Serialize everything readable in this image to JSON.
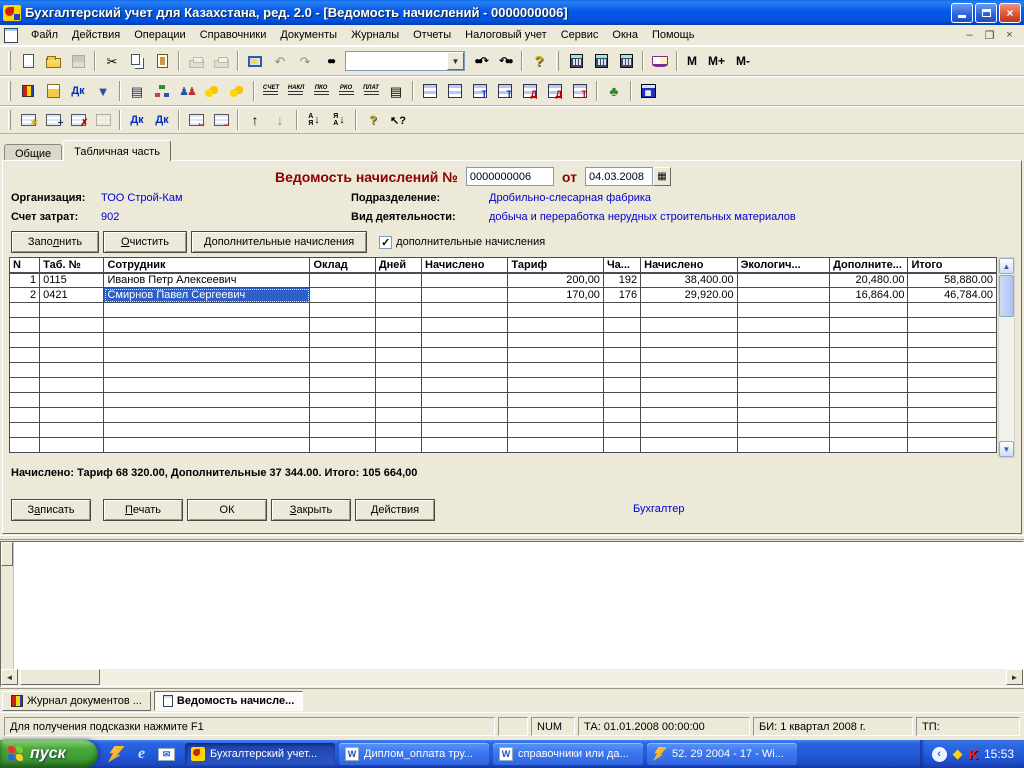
{
  "title_bar": {
    "title": "Бухгалтерский учет для Казахстана, ред. 2.0 - [Ведомость начислений - 0000000006]"
  },
  "menu_bar": {
    "items": [
      "Файл",
      "Действия",
      "Операции",
      "Справочники",
      "Документы",
      "Журналы",
      "Отчеты",
      "Налоговый учет",
      "Сервис",
      "Окна",
      "Помощь"
    ]
  },
  "toolbars": {
    "memory": [
      "M",
      "M+",
      "M-"
    ],
    "doc_buttons": [
      "СЧЕТ",
      "НАКЛ",
      "ПКО",
      "РКО",
      "ПЛАТ"
    ],
    "dk": "Дк",
    "sort_a": "А",
    "sort_z": "Я",
    "find_value": ""
  },
  "tabs": {
    "items": [
      "Общие",
      "Табличная часть"
    ]
  },
  "form": {
    "doc_title": "Ведомость начислений №",
    "doc_number": "0000000006",
    "from_label": "от",
    "doc_date": "04.03.2008",
    "org_label": "Организация:",
    "org_value": "ТОО Строй-Кам",
    "dept_label": "Подразделение:",
    "dept_value": "Дробильно-слесарная фабрика",
    "account_label": "Счет затрат:",
    "account_value": "902",
    "activity_label": "Вид деятельности:",
    "activity_value": "добыча и переработка нерудных строительных материалов",
    "fill": [
      "Запо",
      "л",
      "нить"
    ],
    "clear": [
      "",
      "О",
      "чистить"
    ],
    "additional": "Дополнительные начисления",
    "checkbox_label": "дополнительные начисления",
    "checkbox_checked": "✓",
    "totals": "Начислено: Тариф 68 320.00, Дополнительные 37 344.00. Итого: 105 664,00"
  },
  "table": {
    "columns": [
      "N",
      "Таб. №",
      "Сотрудник",
      "Оклад",
      "Дней",
      "Начислено",
      "Тариф",
      "Ча...",
      "Начислено",
      "Экологич...",
      "Дополните...",
      "Итого"
    ],
    "rows": [
      [
        "1",
        "0115",
        "Иванов Петр Алексеевич",
        "",
        "",
        "",
        "200,00",
        "192",
        "38,400.00",
        "",
        "20,480.00",
        "58,880.00"
      ],
      [
        "2",
        "0421",
        "Смирнов Павел Сергеевич",
        "",
        "",
        "",
        "170,00",
        "176",
        "29,920.00",
        "",
        "16,864.00",
        "46,784.00"
      ]
    ]
  },
  "footer": {
    "save": [
      "З",
      "а",
      "писать"
    ],
    "print": [
      "",
      "П",
      "ечать"
    ],
    "ok": "ОК",
    "close": [
      "",
      "З",
      "акрыть"
    ],
    "actions": [
      "",
      "Д",
      "ействия"
    ],
    "signature": "Бухгалтер"
  },
  "mdi_tabs": {
    "journal": "Журнал документов ...",
    "current": "Ведомость начисле..."
  },
  "status_bar": {
    "hint": "Для получения подсказки нажмите F1",
    "num": "NUM",
    "ta": "ТА: 01.01.2008  00:00:00",
    "bi": "БИ: 1 квартал 2008 г.",
    "tp": "ТП:"
  },
  "taskbar": {
    "start": "пуск",
    "tasks": [
      "Бухгалтерский учет...",
      "Диплом_оплата тру...",
      "справочники или да...",
      "52. 29 2004 - 17 - Wi..."
    ],
    "time": "15:53"
  }
}
